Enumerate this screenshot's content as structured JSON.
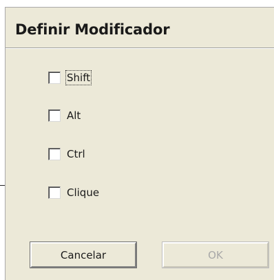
{
  "dialog": {
    "title": "Definir Modificador",
    "options": [
      {
        "label": "Shift",
        "checked": false,
        "focused": true
      },
      {
        "label": "Alt",
        "checked": false,
        "focused": false
      },
      {
        "label": "Ctrl",
        "checked": false,
        "focused": false
      },
      {
        "label": "Clique",
        "checked": false,
        "focused": false
      }
    ],
    "buttons": {
      "cancel_label": "Cancelar",
      "ok_label": "OK",
      "ok_enabled": false
    }
  }
}
